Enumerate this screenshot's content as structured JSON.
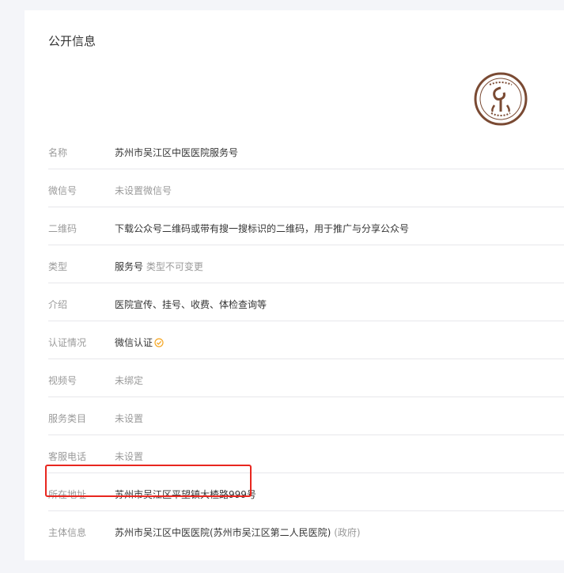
{
  "page": {
    "title": "公开信息"
  },
  "rows": [
    {
      "label": "名称",
      "value": "苏州市吴江区中医医院服务号",
      "muted": false
    },
    {
      "label": "微信号",
      "value": "未设置微信号",
      "muted": true
    },
    {
      "label": "二维码",
      "value": "下载公众号二维码或带有搜一搜标识的二维码，用于推广与分享公众号",
      "muted": false
    },
    {
      "label": "类型",
      "value": "服务号",
      "sub": "类型不可变更",
      "muted": false
    },
    {
      "label": "介绍",
      "value": "医院宣传、挂号、收费、体检查询等",
      "muted": false
    },
    {
      "label": "认证情况",
      "value": "微信认证",
      "muted": false,
      "icon": "verified-check-icon"
    },
    {
      "label": "视频号",
      "value": "未绑定",
      "muted": true
    },
    {
      "label": "服务类目",
      "value": "未设置",
      "muted": true
    },
    {
      "label": "客服电话",
      "value": "未设置",
      "muted": true
    },
    {
      "label": "所在地址",
      "value": "苏州市吴江区平望镇大楂路999号",
      "muted": false,
      "highlighted": true
    },
    {
      "label": "主体信息",
      "value": "苏州市吴江区中医医院(苏州市吴江区第二人民医院)",
      "sub": "(政府)",
      "muted": false
    }
  ],
  "colors": {
    "highlight": "#e8261f",
    "logo": "#7a4a33",
    "verified": "#f5a623"
  }
}
